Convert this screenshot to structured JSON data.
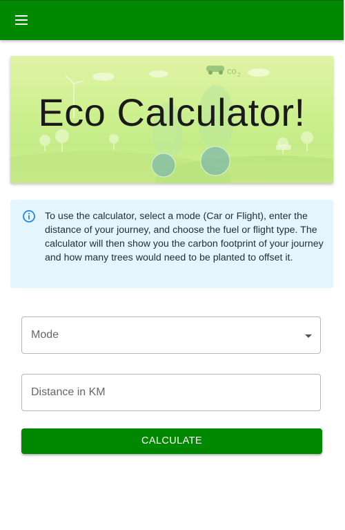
{
  "appbar": {
    "menu_icon": "hamburger-menu-icon",
    "color": "#008800"
  },
  "hero": {
    "title": "Eco Calculator!",
    "background_text": "co",
    "background_subscript": "2"
  },
  "info": {
    "icon": "info-circle-icon",
    "icon_color": "#1e88e5",
    "text": "To use the calculator, select a mode (Car or Flight), enter the distance of your journey, and choose the fuel or flight type. The calculator will then show you the carbon footprint of your journey and how many trees would need to be planted to offset it."
  },
  "form": {
    "mode_label": "Mode",
    "distance_placeholder": "Distance in KM",
    "calculate_label": "CALCULATE"
  },
  "colors": {
    "primary": "#008800",
    "info_bg": "#e5f5fd"
  }
}
